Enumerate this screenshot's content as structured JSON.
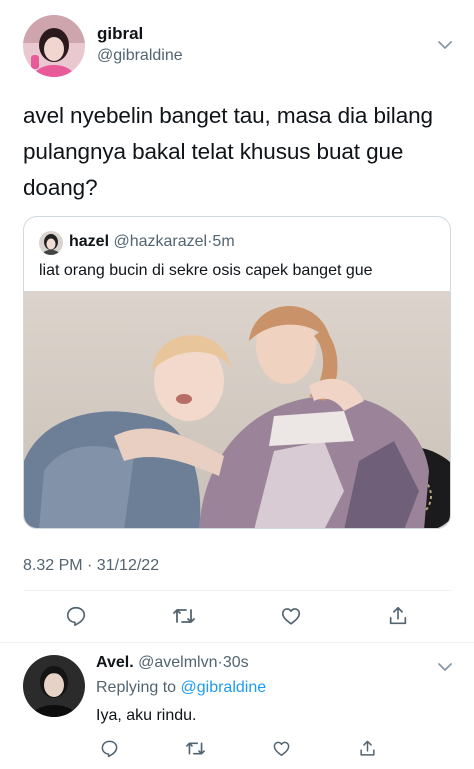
{
  "tweet": {
    "author_name": "gibral",
    "author_handle": "@gibraldine",
    "text": "avel nyebelin banget tau, masa dia bilang pulangnya bakal telat khusus buat gue doang?",
    "timestamp": "8.32 PM · 31/12/22",
    "avatar_icon": "profile-photo",
    "more_icon": "chevron-down-icon"
  },
  "quote": {
    "author_name": "hazel",
    "author_handle": "@hazkarazel",
    "separator": "·",
    "time": "5m",
    "text": "liat orang bucin di sekre osis capek banget gue",
    "image_icon": "photo-two-people"
  },
  "actions": [
    {
      "name": "reply",
      "icon": "comment-icon"
    },
    {
      "name": "retweet",
      "icon": "retweet-icon"
    },
    {
      "name": "like",
      "icon": "heart-icon"
    },
    {
      "name": "share",
      "icon": "share-icon"
    }
  ],
  "reply": {
    "author_name": "Avel.",
    "author_handle": "@avelmlvn",
    "separator": "·",
    "time": "30s",
    "replying_to_label": "Replying to",
    "replying_to_handle": "@gibraldine",
    "text": "Iya, aku rindu."
  },
  "colors": {
    "text": "#0f1419",
    "secondary": "#536471",
    "link": "#1d9bf0",
    "border": "#cfd9de"
  }
}
